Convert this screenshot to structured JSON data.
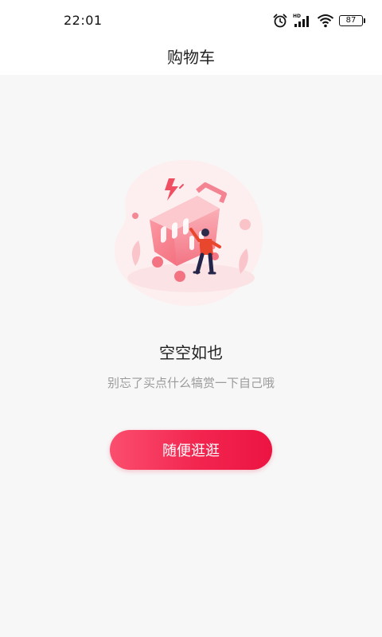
{
  "status_bar": {
    "time": "22:01",
    "signal_label": "HD",
    "battery": "87",
    "icons": [
      "alarm-icon",
      "signal-icon",
      "wifi-icon",
      "battery-icon"
    ]
  },
  "header": {
    "title": "购物车"
  },
  "empty_state": {
    "illustration": "empty-cart-illustration",
    "title": "空空如也",
    "subtitle": "别忘了买点什么犒赏一下自己哦",
    "button_label": "随便逛逛"
  },
  "colors": {
    "accent": "#f2254f",
    "accent_light": "#fb4e6e",
    "background": "#f7f7f7",
    "subtitle": "#9b9b9b"
  }
}
